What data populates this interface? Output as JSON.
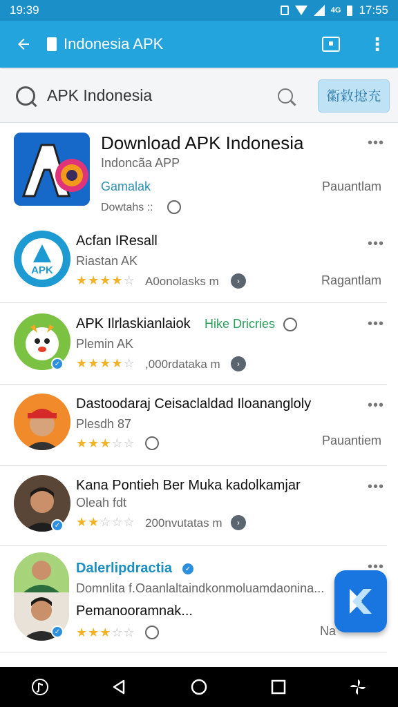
{
  "status_bar": {
    "time_left": "19:39",
    "time_right": "17:55",
    "network": "4G"
  },
  "app_bar": {
    "back_icon": "arrow-left-icon",
    "title": "Indonesia APK"
  },
  "search": {
    "query": "APK Indonesia",
    "button_label": "𧗼敹搃充"
  },
  "items": [
    {
      "title": "Download APK Indonesia",
      "subtitle": "Indoncãa APP",
      "category": "Gamalak",
      "downloads": "Dowtahs ::",
      "right": "Pauantlam",
      "icon": "apk-a-logo-icon"
    },
    {
      "title": "Acfan IResall",
      "subtitle": "Riastan AK",
      "rating": 3.5,
      "count": "A0onolasks m",
      "right": "Ragantlam",
      "icon": "apk-circle-logo-icon",
      "logo_text": "APK"
    },
    {
      "title": "APK Ilrlaskianlaiok",
      "tag": "Hike Dricries",
      "subtitle": "Plemin AK",
      "rating": 4.5,
      "count": ",000rdataka m",
      "icon": "mascot-icon"
    },
    {
      "title": "Dastoodaraj Ceisaclaldad Iloanangloly",
      "subtitle": "Plesdh 87",
      "rating": 3,
      "right": "Pauantiem",
      "icon": "man-red-cap-avatar"
    },
    {
      "title": "Kana Pontieh Ber Muka kadolkamjar",
      "subtitle": "Oleah fdt",
      "rating": 2,
      "count": "200nvutatas m",
      "icon": "man-avatar"
    },
    {
      "title": "Dalerlipdractia",
      "desc": "Domnlita f.Oaanlaltaindkonmoluamdaonina...",
      "subtitle": "Pemanooramnak...",
      "rating": 3,
      "right": "Na",
      "icon": "two-men-avatar"
    }
  ],
  "nav": [
    "tiktok-icon",
    "back-triangle-icon",
    "home-circle-icon",
    "recents-square-icon",
    "pinwheel-icon"
  ],
  "fab": {
    "icon": "kodi-logo-icon"
  },
  "colors": {
    "app_bar": "#24a4dc",
    "status_bar": "#1b8fc7",
    "star": "#f2b227",
    "fab": "#1976e0"
  }
}
